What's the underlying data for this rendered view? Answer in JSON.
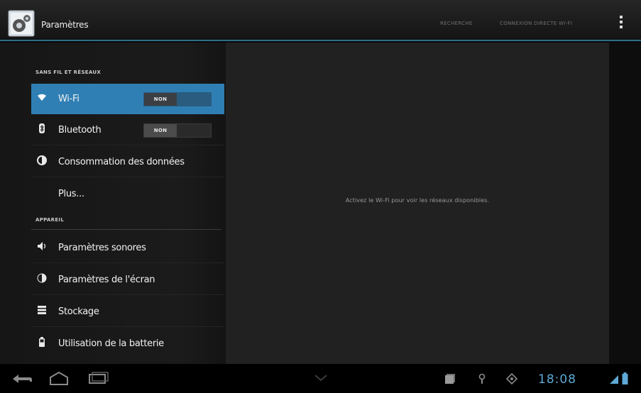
{
  "action_bar": {
    "title": "Paramètres",
    "actions": [
      {
        "label": "RECHERCHE"
      },
      {
        "label": "CONNEXION DIRECTE WI-FI"
      }
    ],
    "overflow_icon": "overflow-menu-icon"
  },
  "sidebar": {
    "section_wireless": "SANS FIL ET RÉSEAUX",
    "section_device": "APPAREIL",
    "items": [
      {
        "label": "Wi-Fi",
        "icon": "wifi-icon",
        "switch": "NON",
        "selected": true
      },
      {
        "label": "Bluetooth",
        "icon": "bluetooth-icon",
        "switch": "NON",
        "selected": false
      },
      {
        "label": "Consommation des données",
        "icon": "data-usage-icon"
      },
      {
        "label": "Plus..."
      },
      {
        "label": "Paramètres sonores",
        "icon": "sound-icon"
      },
      {
        "label": "Paramètres de l'écran",
        "icon": "display-icon"
      },
      {
        "label": "Stockage",
        "icon": "storage-icon"
      },
      {
        "label": "Utilisation de la batterie",
        "icon": "battery-icon"
      }
    ]
  },
  "detail": {
    "message": "Activez le Wi-Fi pour voir les réseaux disponibles."
  },
  "system_bar": {
    "clock": "18:08",
    "accent_color": "#5ea9d6"
  },
  "colors": {
    "selection": "#2f7fb4",
    "action_bar_divider": "#2c6e86"
  }
}
